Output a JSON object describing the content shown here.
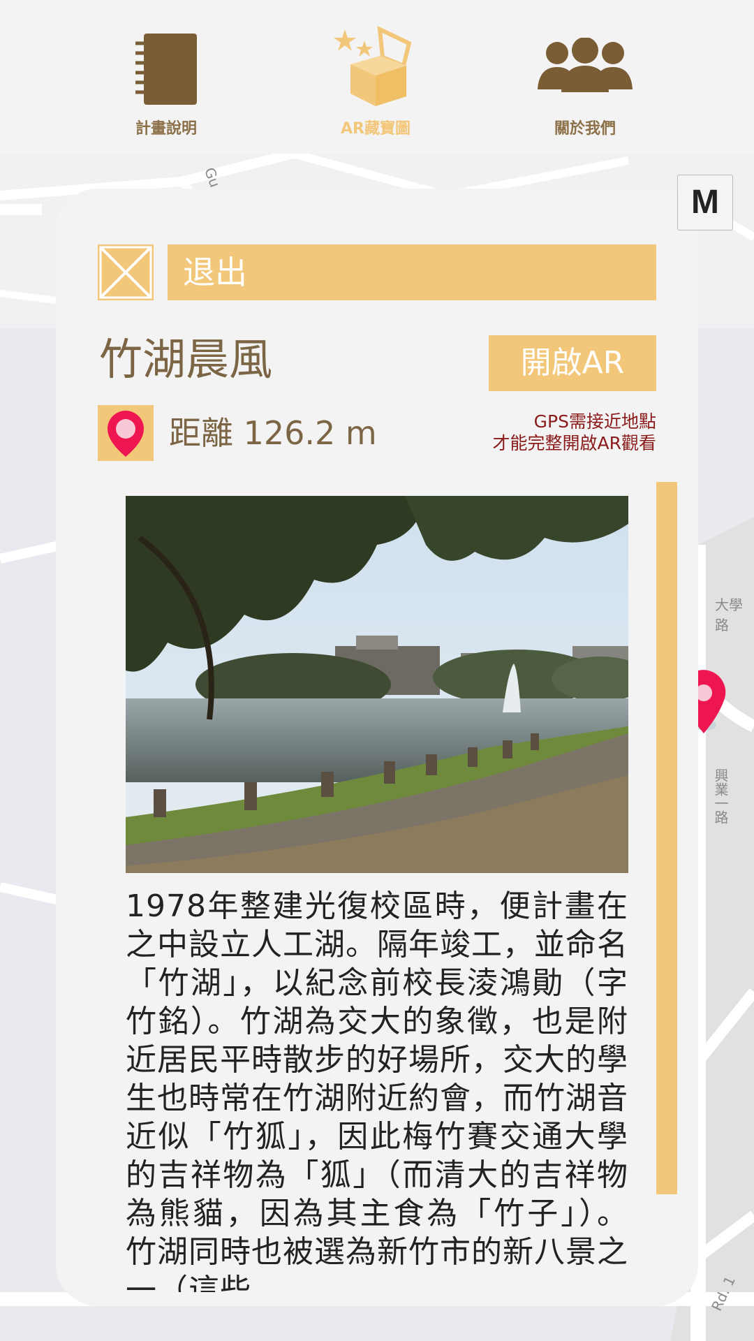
{
  "nav": {
    "items": [
      {
        "label": "計畫說明",
        "icon": "notebook-icon"
      },
      {
        "label": "AR藏寶圖",
        "icon": "treasure-box-icon",
        "active": true
      },
      {
        "label": "關於我們",
        "icon": "group-icon"
      }
    ],
    "active_color": "#f2c77a",
    "inactive_color": "#8b7048"
  },
  "map": {
    "labels": [
      "大學路",
      "Gu",
      "Rd. 1",
      "興業一路"
    ],
    "mode_button": "M"
  },
  "panel": {
    "exit_label": "退出",
    "title": "竹湖晨風",
    "ar_button": "開啟AR",
    "distance": "距離 126.2 m",
    "gps_note_line1": "GPS需接近地點",
    "gps_note_line2": "才能完整開啟AR觀看",
    "description": "1978年整建光復校區時，便計畫在之中設立人工湖。隔年竣工，並命名「竹湖」，以紀念前校長淩鴻勛（字竹銘）。竹湖為交大的象徵，也是附近居民平時散步的好場所，交大的學生也時常在竹湖附近約會，而竹湖音近似「竹狐」，因此梅竹賽交通大學的吉祥物為「狐」（而清大的吉祥物為熊貓，因為其主食為「竹子」）。竹湖同時也被選為新竹市的新八景之一（這些"
  },
  "colors": {
    "accent": "#f2c77a",
    "title_brown": "#7b6545",
    "note_red": "#8b1a1a",
    "pin_red": "#ee1650"
  }
}
